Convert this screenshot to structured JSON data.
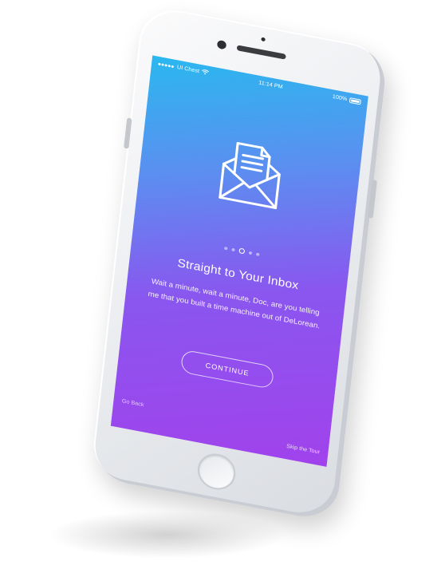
{
  "status_bar": {
    "carrier": "UI Chest",
    "time": "11:14 PM",
    "battery": "100%"
  },
  "icons": {
    "mail": "envelope-letter-icon",
    "wifi": "wifi-icon",
    "signal": "signal-icon",
    "battery": "battery-icon"
  },
  "pager": {
    "total": 5,
    "active_index": 2
  },
  "onboarding": {
    "title": "Straight to Your Inbox",
    "body": "Wait a minute, wait a minute, Doc, are you telling me that you built a time machine out of DeLorean.",
    "continue_label": "CONTINUE",
    "go_back_label": "Go Back",
    "skip_label": "Skip the Tour"
  },
  "colors": {
    "gradient_top": "#2ab8ef",
    "gradient_bottom": "#a142ec",
    "text": "#ffffff"
  }
}
